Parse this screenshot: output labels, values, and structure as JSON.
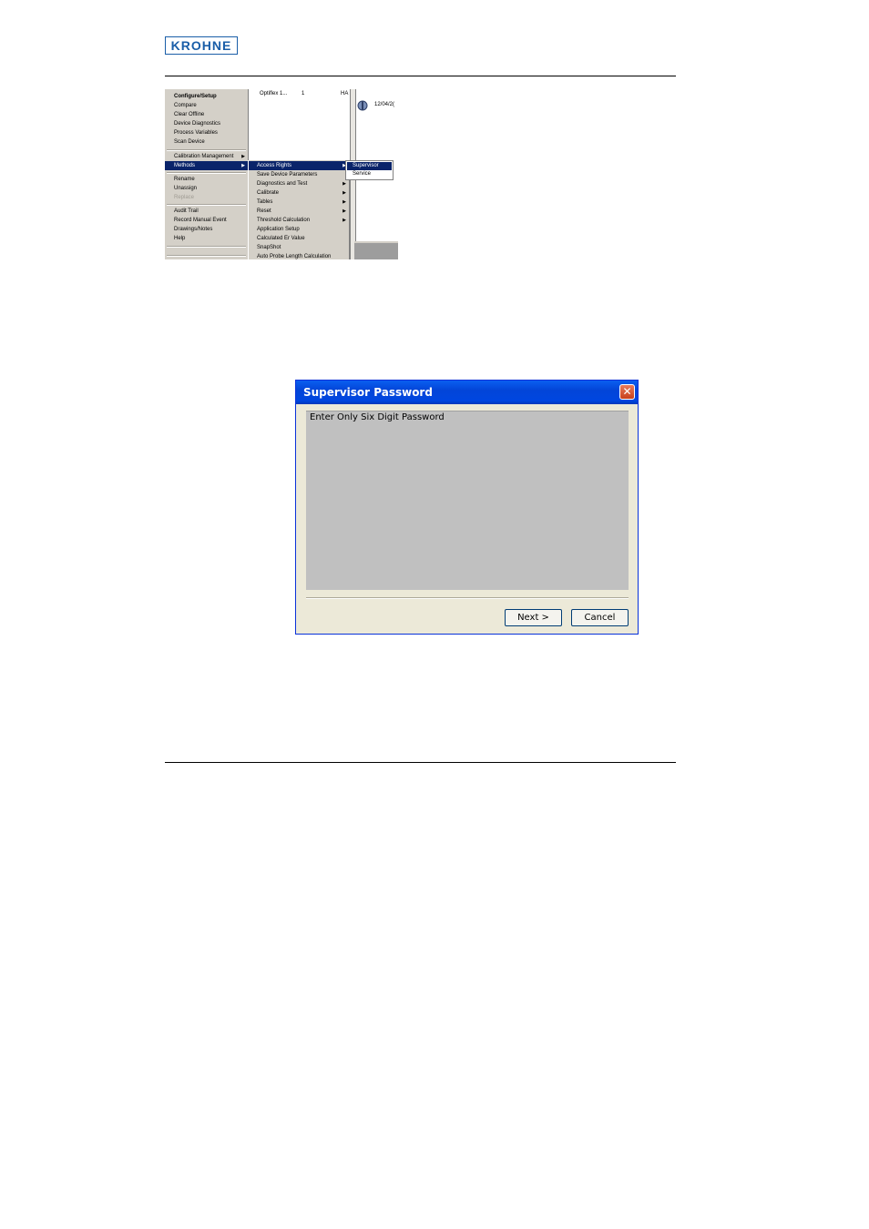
{
  "header": {
    "logo_text": "KROHNE"
  },
  "screenshot": {
    "main_menu": [
      {
        "label": "Configure/Setup",
        "bold": true
      },
      {
        "label": "Compare"
      },
      {
        "label": "Clear Offline"
      },
      {
        "label": "Device Diagnostics"
      },
      {
        "label": "Process Variables"
      },
      {
        "label": "Scan Device"
      },
      {
        "label": "Calibration Management"
      },
      {
        "label": "Methods"
      },
      {
        "label": "Rename"
      },
      {
        "label": "Unassign"
      },
      {
        "label": "Replace"
      },
      {
        "label": "Audit Trail"
      },
      {
        "label": "Record Manual Event"
      },
      {
        "label": "Drawings/Notes"
      },
      {
        "label": "Help"
      }
    ],
    "background": {
      "device_name": "Optiflex 1...",
      "column_value": "1",
      "column_ha": "HA",
      "date": "12/04/2("
    },
    "methods_submenu": [
      {
        "label": "Access Rights"
      },
      {
        "label": "Save Device Parameters"
      },
      {
        "label": "Diagnostics and Test"
      },
      {
        "label": "Calibrate"
      },
      {
        "label": "Tables"
      },
      {
        "label": "Reset"
      },
      {
        "label": "Threshold Calculation"
      },
      {
        "label": "Application Setup"
      },
      {
        "label": "Calculated Er Value"
      },
      {
        "label": "SnapShot"
      },
      {
        "label": "Auto Probe Length Calculation"
      }
    ],
    "access_submenu": [
      {
        "label": "Supervisor"
      },
      {
        "label": "Service"
      }
    ]
  },
  "dialog": {
    "title": "Supervisor Password",
    "prompt": "Enter Only Six Digit Password",
    "next_label": "Next >",
    "cancel_label": "Cancel",
    "close_glyph": "✕"
  }
}
